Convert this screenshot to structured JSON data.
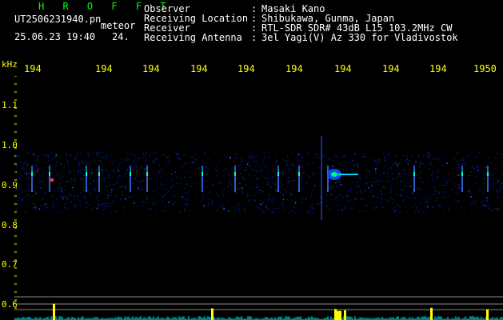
{
  "header": {
    "title": "H R O F F T",
    "filename": "UT2506231940.pn",
    "algorithm": "meteor",
    "datetime": "25.06.23 19:40",
    "value": "24.",
    "info": [
      {
        "label": "Observer",
        "value": "Masaki Kano"
      },
      {
        "label": "Receiving Location",
        "value": "Shibukawa, Gunma, Japan"
      },
      {
        "label": "Receiver",
        "value": "RTL-SDR SDR# 43dB L15 103.2MHz CW"
      },
      {
        "label": "Receiving Antenna",
        "value": "3el Yagi(V) Az 330 for Vladivostok"
      }
    ]
  },
  "plot": {
    "unit": "kHz",
    "x_ticks": [
      "194",
      "194",
      "194",
      "194",
      "194",
      "194",
      "194",
      "194",
      "194",
      "1950"
    ],
    "y_ticks": [
      "1.1",
      "1.0",
      "0.9",
      "0.8",
      "0.7",
      "0.6"
    ],
    "colors": {
      "text": "#ffffff",
      "axis": "#ffff00",
      "title": "#00ff00",
      "noise": "#001a6e",
      "signal": "#00ff55",
      "bar": "#ffff00",
      "baseline": "#00ffff"
    }
  }
}
